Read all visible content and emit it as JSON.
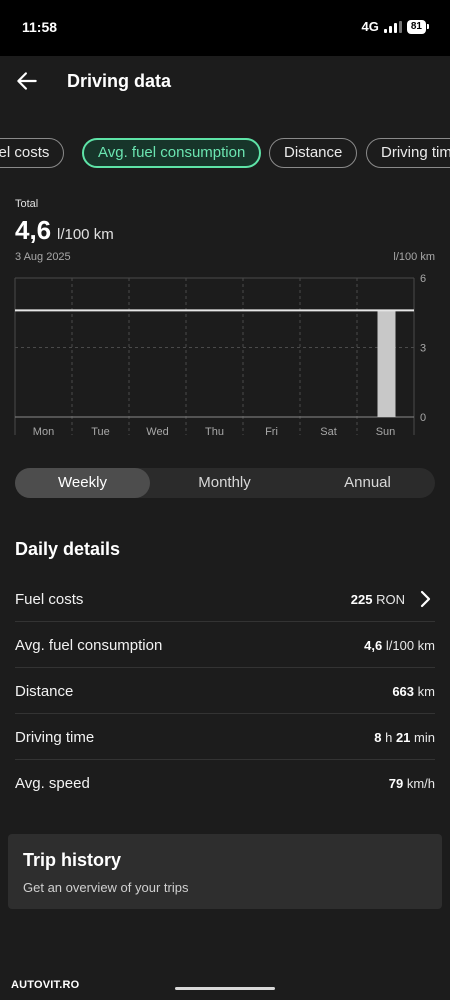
{
  "status_bar": {
    "time": "11:58",
    "network": "4G",
    "battery": "81"
  },
  "header": {
    "title": "Driving data",
    "back_icon": "arrow-left-icon"
  },
  "chips": [
    {
      "label": "Fuel costs",
      "active": false
    },
    {
      "label": "Avg. fuel consumption",
      "active": true
    },
    {
      "label": "Distance",
      "active": false
    },
    {
      "label": "Driving time",
      "active": false
    }
  ],
  "summary": {
    "label": "Total",
    "value": "4,6",
    "unit": "l/100 km",
    "date": "3 Aug 2025",
    "y_unit": "l/100 km"
  },
  "chart_data": {
    "type": "bar",
    "categories": [
      "Mon",
      "Tue",
      "Wed",
      "Thu",
      "Fri",
      "Sat",
      "Sun"
    ],
    "values": [
      0,
      0,
      0,
      0,
      0,
      0,
      4.6
    ],
    "reference_line": 4.6,
    "ylim": [
      0,
      6
    ],
    "yticks": [
      0,
      3,
      6
    ],
    "ylabel": "l/100 km",
    "grid": true,
    "colors": {
      "bar": "#c8c8c8",
      "line": "#e6e6e6",
      "grid": "#4a4a4a",
      "axis": "#8a8a8a",
      "tick_label": "#a8a8a8"
    }
  },
  "period_tabs": [
    {
      "label": "Weekly",
      "active": true
    },
    {
      "label": "Monthly",
      "active": false
    },
    {
      "label": "Annual",
      "active": false
    }
  ],
  "daily_details": {
    "title": "Daily details",
    "rows": [
      {
        "label": "Fuel costs",
        "v1": "225",
        "u1": "RON",
        "v2": "",
        "u2": "",
        "chevron": true
      },
      {
        "label": "Avg. fuel consumption",
        "v1": "4,6",
        "u1": "l/100 km",
        "v2": "",
        "u2": "",
        "chevron": false
      },
      {
        "label": "Distance",
        "v1": "663",
        "u1": "km",
        "v2": "",
        "u2": "",
        "chevron": false
      },
      {
        "label": "Driving time",
        "v1": "8",
        "u1": "h",
        "v2": "21",
        "u2": "min",
        "chevron": false
      },
      {
        "label": "Avg. speed",
        "v1": "79",
        "u1": "km/h",
        "v2": "",
        "u2": "",
        "chevron": false
      }
    ]
  },
  "trip_history": {
    "title": "Trip history",
    "subtitle": "Get an overview of your trips"
  },
  "watermark": "AUTOVIT.RO",
  "colors": {
    "accent": "#5ee3a7",
    "background": "#1c1c1c",
    "status_bar": "#000000"
  }
}
